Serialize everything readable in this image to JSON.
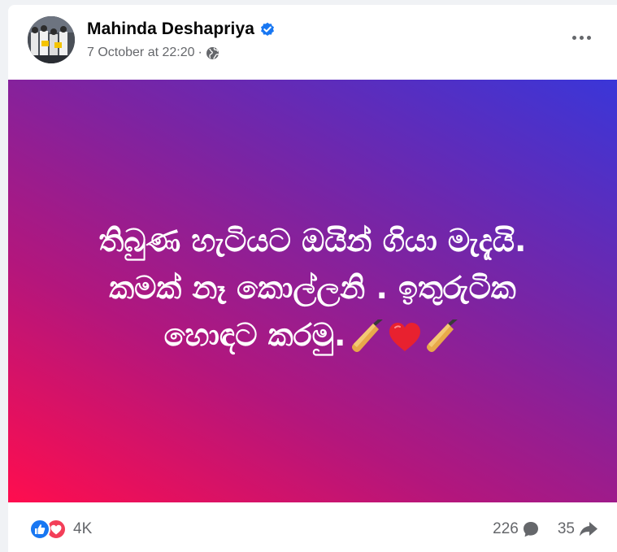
{
  "post": {
    "author": "Mahinda Deshapriya",
    "timestamp": "7 October at 22:20",
    "separator": "·",
    "verified_icon": "verified-badge-icon",
    "audience_icon": "globe-icon",
    "body_lines": [
      "තිබුණ හැටියට ඔයින් ගියා මැදැයි.",
      "කමක් නෑ කොල්ලනි . ඉතුරුටික",
      "හොඳට කරමු."
    ],
    "emoji": [
      "cricket-bat-icon",
      "red-heart-icon",
      "cricket-bat-icon"
    ],
    "background_gradient": [
      "#ff0d4e",
      "#b4167c",
      "#7b24a3",
      "#3a36d8"
    ]
  },
  "footer": {
    "reaction_icons": [
      "like-icon",
      "love-icon"
    ],
    "reaction_count": "4K",
    "comment_count": "226",
    "share_count": "35"
  },
  "colors": {
    "like_blue": "#1877f2",
    "love_red": "#f33e58",
    "muted_text": "#65676b"
  }
}
